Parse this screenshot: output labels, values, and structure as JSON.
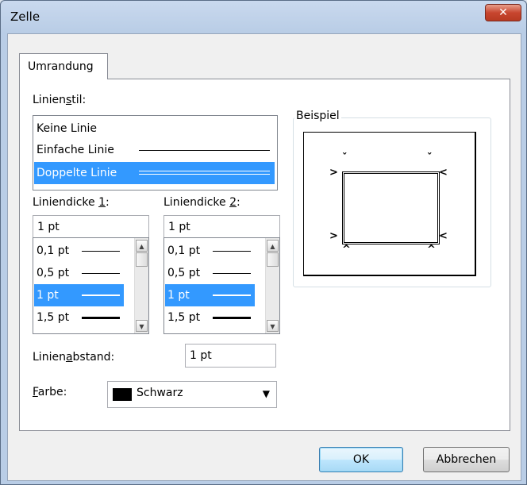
{
  "window": {
    "title": "Zelle",
    "close_glyph": "✕"
  },
  "tab": {
    "label": "Umrandung"
  },
  "linienstil": {
    "label_pre": "Linien",
    "label_u": "s",
    "label_post": "til:",
    "items": [
      "Keine Linie",
      "Einfache Linie",
      "Doppelte Linie"
    ],
    "selected": "Doppelte Linie"
  },
  "liniendicke1": {
    "label_pre": "Liniendicke ",
    "label_u": "1",
    "label_post": ":",
    "value": "1 pt",
    "items": [
      "0,1 pt",
      "0,5 pt",
      "1 pt",
      "1,5 pt"
    ],
    "selected": "1 pt"
  },
  "liniendicke2": {
    "label_pre": "Liniendicke ",
    "label_u": "2",
    "label_post": ":",
    "value": "1 pt",
    "items": [
      "0,1 pt",
      "0,5 pt",
      "1 pt",
      "1,5 pt"
    ],
    "selected": "1 pt"
  },
  "linienabstand": {
    "label_pre": "Linien",
    "label_u": "a",
    "label_post": "bstand:",
    "value": "1 pt"
  },
  "farbe": {
    "label_u": "F",
    "label_post": "arbe:",
    "value": "Schwarz",
    "swatch_color": "#000000"
  },
  "beispiel": {
    "label": "Beispiel"
  },
  "buttons": {
    "ok": "OK",
    "cancel": "Abbrechen"
  },
  "colors": {
    "selection": "#3399ff",
    "close_button": "#c8462f"
  }
}
